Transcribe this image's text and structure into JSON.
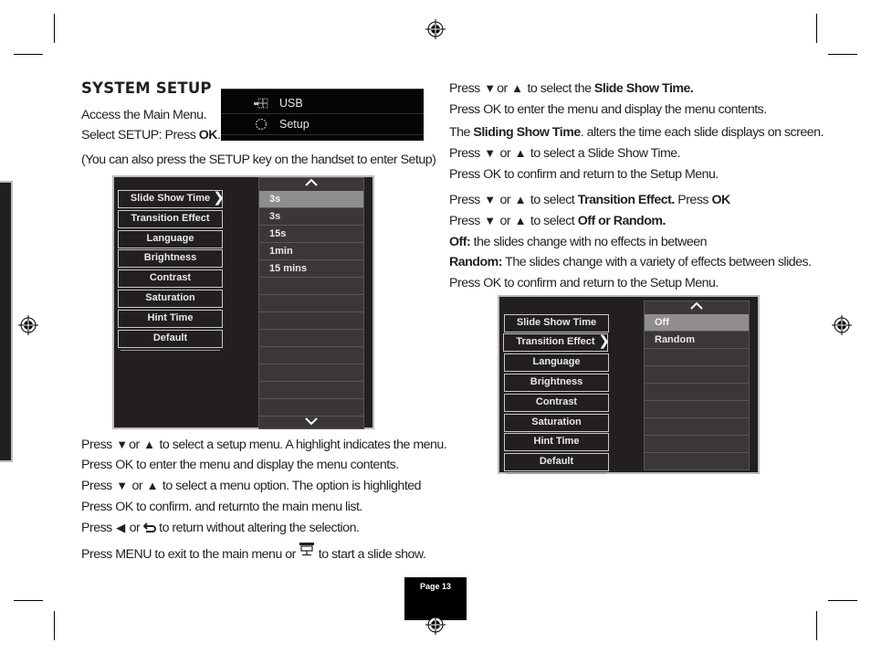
{
  "heading": "SYSTEM SETUP",
  "intro": {
    "line1": "Access the Main Menu.",
    "line2_prefix": "Select SETUP: Press ",
    "line2_bold": "OK",
    "line2_suffix": ".",
    "line3": "(You can also press the SETUP key on the handset to enter Setup)"
  },
  "main_menu": {
    "items": [
      {
        "label": "USB",
        "icon": "usb-icon"
      },
      {
        "label": "Setup",
        "icon": "setup-gear-icon"
      }
    ]
  },
  "screen1": {
    "menu_items": [
      "Slide Show Time",
      "Transition Effect",
      "Language",
      "Brightness",
      "Contrast",
      "Saturation",
      "Hint Time",
      "Default"
    ],
    "active_item": "Slide Show Time",
    "options": [
      "3s",
      "3s",
      "15s",
      "1min",
      "15 mins"
    ],
    "selected_option": "3s",
    "up_arrow": "^",
    "down_arrow": "v"
  },
  "screen2": {
    "menu_items": [
      "Slide Show Time",
      "Transition Effect",
      "Language",
      "Brightness",
      "Contrast",
      "Saturation",
      "Hint Time",
      "Default"
    ],
    "active_item": "Transition Effect",
    "options": [
      "Off",
      "Random"
    ],
    "selected_option": "Off"
  },
  "left_instructions": {
    "l1_a": "Press ",
    "l1_b": "or ",
    "l1_c": " to select a setup menu. A highlight indicates the menu.",
    "l2": "Press OK to enter the menu and display the menu contents.",
    "l3_a": "Press ",
    "l3_b": " or ",
    "l3_c": " to select a menu option. The option is highlighted",
    "l4": "Press OK to confirm. and  returnto the main menu list.",
    "l5_a": "Press ",
    "l5_b": " or ",
    "l5_c": " to return without altering the selection.",
    "l6_a": "Press MENU to exit to the main menu or ",
    "l6_b": "  to start a slide show."
  },
  "right_instructions": {
    "r1_a": "Press ",
    "r1_b": "or ",
    "r1_c": " to select the ",
    "r1_bold": "Slide Show Time.",
    "r2": "Press OK to enter the menu and display the menu contents.",
    "r3_a": "The ",
    "r3_bold": "Sliding Show Time",
    "r3_c": ". alters the time each slide displays on screen.",
    "r4_a": "Press ",
    "r4_b": " or ",
    "r4_c": " to select a Slide Show Time.",
    "r5": "Press OK to confirm and return to the Setup Menu.",
    "r6_a": "Press ",
    "r6_b": " or ",
    "r6_c": " to select ",
    "r6_bold1": "Transition Effect.",
    "r6_d": " Press ",
    "r6_bold2": "OK",
    "r7_a": "Press ",
    "r7_b": " or ",
    "r7_c": " to select ",
    "r7_bold": "Off or Random.",
    "r8_bold": "Off:",
    "r8": " the slides change with no effects in between",
    "r9_bold": "Random:",
    "r9": " The slides change with a variety of effects between slides.",
    "r10": "Press OK to confirm and return to the Setup Menu."
  },
  "glyphs": {
    "down": "▼",
    "up": "▲",
    "left": "◀",
    "back": "⮌"
  },
  "page_label": "Page 13"
}
